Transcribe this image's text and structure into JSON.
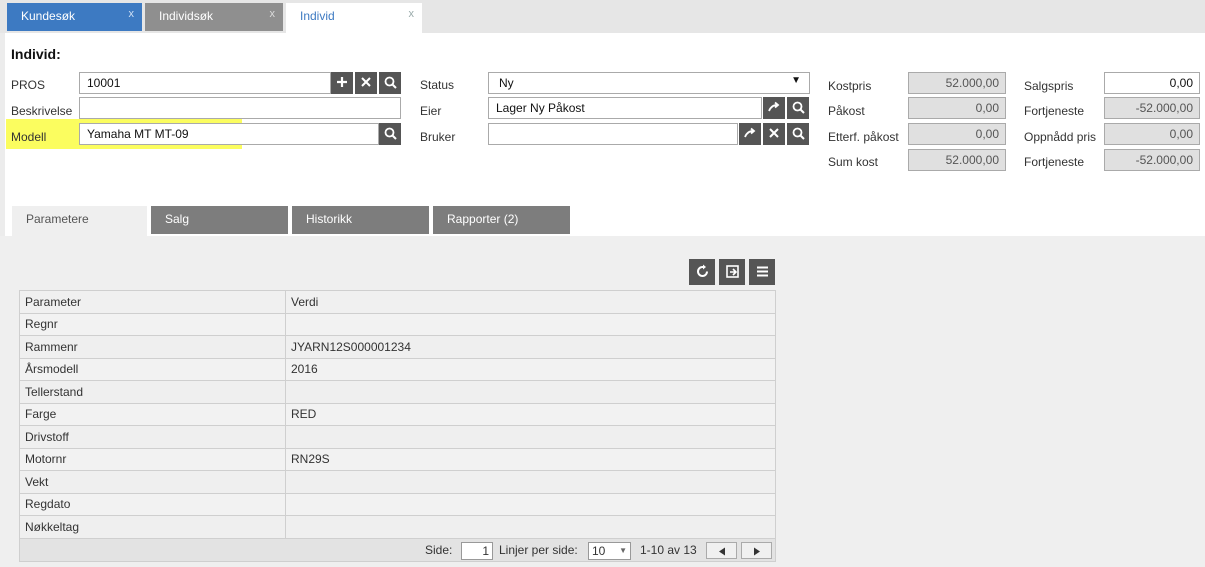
{
  "tabs": [
    {
      "label": "Kundesøk",
      "close": "x"
    },
    {
      "label": "Individsøk",
      "close": "x"
    },
    {
      "label": "Individ",
      "close": "x"
    }
  ],
  "form": {
    "title": "Individ:",
    "pros_label": "PROS",
    "pros_value": "10001",
    "beskrivelse_label": "Beskrivelse",
    "beskrivelse_value": "",
    "modell_label": "Modell",
    "modell_value": "Yamaha MT MT-09",
    "status_label": "Status",
    "status_value": "Ny",
    "eier_label": "Eier",
    "eier_value": "Lager Ny Påkost",
    "bruker_label": "Bruker",
    "bruker_value": ""
  },
  "costs": {
    "kostpris_label": "Kostpris",
    "kostpris": "52.000,00",
    "pakost_label": "Påkost",
    "pakost": "0,00",
    "etterf_label": "Etterf. påkost",
    "etterf": "0,00",
    "sumkost_label": "Sum kost",
    "sumkost": "52.000,00",
    "salgspris_label": "Salgspris",
    "salgspris": "0,00",
    "fortjeneste_label": "Fortjeneste",
    "fortjeneste": "-52.000,00",
    "oppnadd_label": "Oppnådd pris",
    "oppnadd": "0,00",
    "fortjeneste2_label": "Fortjeneste",
    "fortjeneste2": "-52.000,00"
  },
  "subtabs": [
    "Parametere",
    "Salg",
    "Historikk",
    "Rapporter (2)"
  ],
  "grid": {
    "headers": [
      "Parameter",
      "Verdi"
    ],
    "rows": [
      [
        "Regnr",
        ""
      ],
      [
        "Rammenr",
        "JYARN12S000001234"
      ],
      [
        "Årsmodell",
        "2016"
      ],
      [
        "Tellerstand",
        ""
      ],
      [
        "Farge",
        "RED"
      ],
      [
        "Drivstoff",
        ""
      ],
      [
        "Motornr",
        "RN29S"
      ],
      [
        "Vekt",
        ""
      ],
      [
        "Regdato",
        ""
      ],
      [
        "Nøkkeltag",
        ""
      ]
    ]
  },
  "pager": {
    "side_label": "Side:",
    "side_value": "1",
    "per_page_label": "Linjer per side:",
    "per_page_value": "10",
    "range": "1-10 av 13"
  },
  "colors": {
    "accent": "#3d7ac2",
    "highlight": "#fbfd5f",
    "button": "#555555"
  }
}
